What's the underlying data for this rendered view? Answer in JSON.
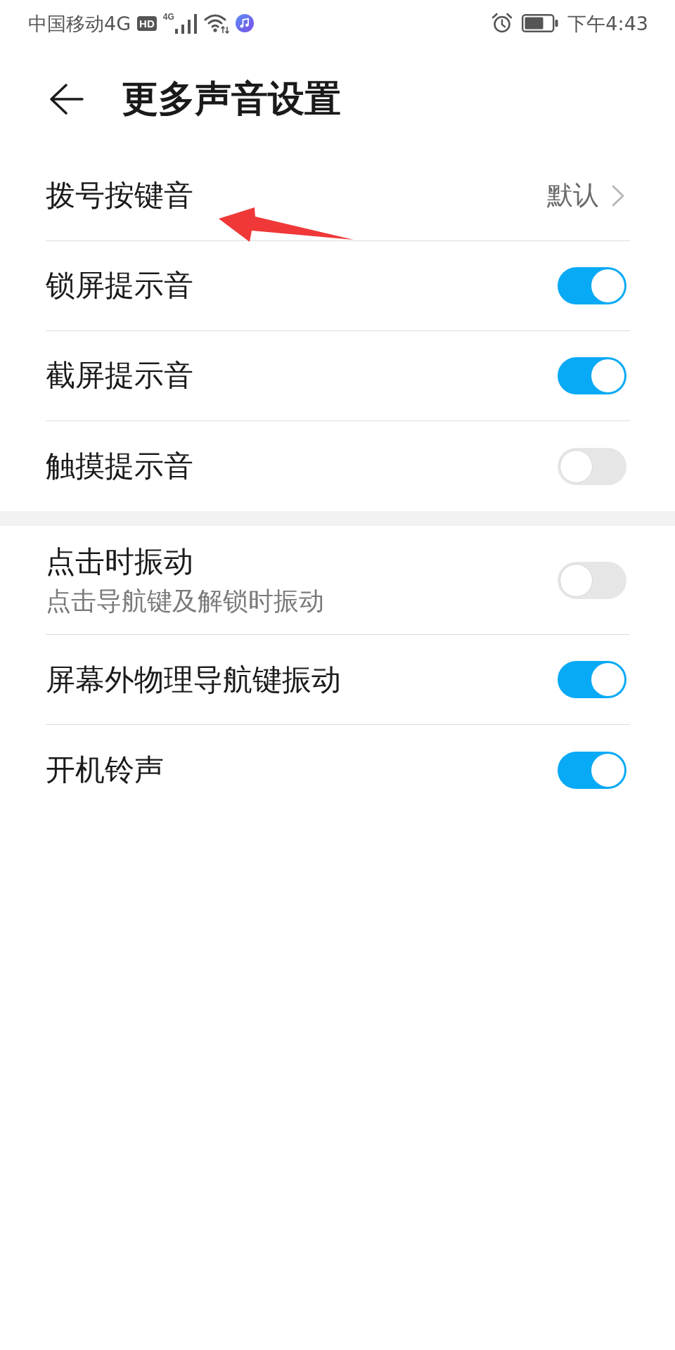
{
  "status_bar": {
    "carrier": "中国移动4G",
    "hd_badge": "HD",
    "network_type": "4G",
    "time": "下午4:43"
  },
  "header": {
    "title": "更多声音设置"
  },
  "sections": [
    {
      "items": [
        {
          "kind": "link",
          "label": "拨号按键音",
          "value": "默认"
        },
        {
          "kind": "switch",
          "label": "锁屏提示音",
          "on": true
        },
        {
          "kind": "switch",
          "label": "截屏提示音",
          "on": true
        },
        {
          "kind": "switch",
          "label": "触摸提示音",
          "on": false
        }
      ]
    },
    {
      "items": [
        {
          "kind": "switch",
          "label": "点击时振动",
          "description": "点击导航键及解锁时振动",
          "on": false
        },
        {
          "kind": "switch",
          "label": "屏幕外物理导航键振动",
          "on": true
        },
        {
          "kind": "switch",
          "label": "开机铃声",
          "on": true
        }
      ]
    }
  ]
}
